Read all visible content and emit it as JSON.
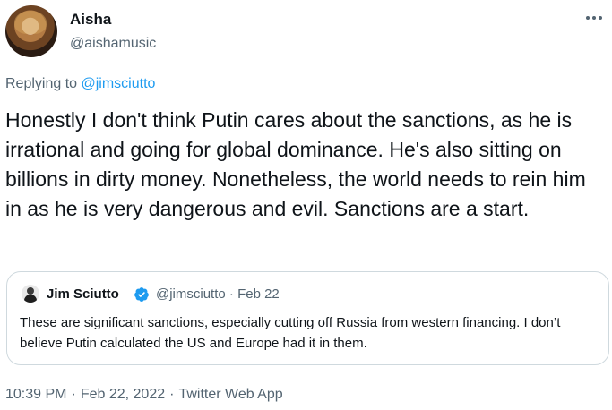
{
  "author": {
    "name": "Aisha",
    "handle": "@aishamusic"
  },
  "reply": {
    "prefix": "Replying to ",
    "target": "@jimsciutto"
  },
  "tweet": {
    "text": "Honestly I don't think Putin cares about the sanctions, as he is irrational and going for global dominance. He's also sitting on billions in dirty money. Nonetheless, the world needs to rein him in as he is very dangerous and evil. Sanctions are a start."
  },
  "quoted": {
    "name": "Jim Sciutto",
    "verified_color": "#1d9bf0",
    "meta": "@jimsciutto · Feb 22",
    "text": "These are significant sanctions, especially cutting off Russia from western financing. I don’t believe Putin calculated the US and Europe had it in them."
  },
  "footer": {
    "time": "10:39 PM",
    "sep1": "·",
    "date": "Feb 22, 2022",
    "sep2": "·",
    "source": "Twitter Web App"
  },
  "icons": {
    "more": "more-dots-icon",
    "verified": "verified-badge-icon"
  }
}
